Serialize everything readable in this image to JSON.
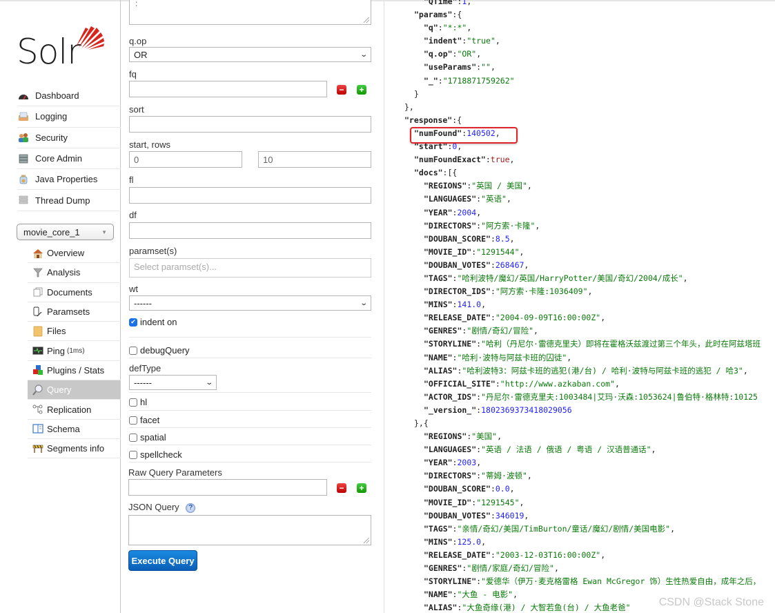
{
  "app": {
    "logo_text": "Solr",
    "brand_color": "#d9261c",
    "accent_color": "#0a6fd0"
  },
  "sidebar": {
    "main_items": [
      {
        "label": "Dashboard",
        "icon": "dashboard-gauge-icon"
      },
      {
        "label": "Logging",
        "icon": "logging-inbox-icon"
      },
      {
        "label": "Security",
        "icon": "security-users-icon"
      },
      {
        "label": "Core Admin",
        "icon": "core-admin-server-icon"
      },
      {
        "label": "Java Properties",
        "icon": "java-properties-jar-icon"
      },
      {
        "label": "Thread Dump",
        "icon": "thread-dump-stack-icon"
      }
    ],
    "core_selector": {
      "value": "movie_core_1"
    },
    "core_items": [
      {
        "label": "Overview",
        "icon": "overview-house-icon"
      },
      {
        "label": "Analysis",
        "icon": "analysis-funnel-icon"
      },
      {
        "label": "Documents",
        "icon": "documents-icon"
      },
      {
        "label": "Paramsets",
        "icon": "paramsets-pencil-icon"
      },
      {
        "label": "Files",
        "icon": "files-folder-icon"
      },
      {
        "label": "Ping",
        "suffix": "(1ms)",
        "icon": "ping-monitor-icon"
      },
      {
        "label": "Plugins / Stats",
        "icon": "plugins-blocks-icon"
      },
      {
        "label": "Query",
        "icon": "query-magnifier-icon",
        "active": true
      },
      {
        "label": "Replication",
        "icon": "replication-nodes-icon"
      },
      {
        "label": "Schema",
        "icon": "schema-book-icon"
      },
      {
        "label": "Segments info",
        "icon": "segments-barrier-icon"
      }
    ]
  },
  "form": {
    "q_value": ":",
    "qop": {
      "label": "q.op",
      "value": "OR"
    },
    "fq": {
      "label": "fq",
      "value": ""
    },
    "sort": {
      "label": "sort",
      "value": ""
    },
    "start_rows": {
      "label": "start, rows",
      "start": "0",
      "rows": "10"
    },
    "fl": {
      "label": "fl",
      "value": ""
    },
    "df": {
      "label": "df",
      "value": ""
    },
    "paramsets": {
      "label": "paramset(s)",
      "placeholder": "Select paramset(s)..."
    },
    "wt": {
      "label": "wt",
      "value": "------"
    },
    "indent": {
      "label": "indent on",
      "checked": true
    },
    "debugQuery": {
      "label": "debugQuery",
      "checked": false
    },
    "defType": {
      "label": "defType",
      "value": "------"
    },
    "hl": {
      "label": "hl",
      "checked": false
    },
    "facet": {
      "label": "facet",
      "checked": false
    },
    "spatial": {
      "label": "spatial",
      "checked": false
    },
    "spellcheck": {
      "label": "spellcheck",
      "checked": false
    },
    "raw": {
      "label": "Raw Query Parameters",
      "value": ""
    },
    "json_query": {
      "label": "JSON Query",
      "help": "?",
      "value": ""
    },
    "execute_label": "Execute Query"
  },
  "response_lines": [
    [
      4,
      [
        [
          "k",
          "\"QTime\""
        ],
        [
          "p",
          ":"
        ],
        [
          "n",
          "1"
        ],
        [
          "p",
          ","
        ]
      ]
    ],
    [
      2,
      [
        [
          "k",
          "\"params\""
        ],
        [
          "p",
          ":{"
        ]
      ]
    ],
    [
      4,
      [
        [
          "k",
          "\"q\""
        ],
        [
          "p",
          ":"
        ],
        [
          "s",
          "\"*:*\""
        ],
        [
          "p",
          ","
        ]
      ]
    ],
    [
      4,
      [
        [
          "k",
          "\"indent\""
        ],
        [
          "p",
          ":"
        ],
        [
          "s",
          "\"true\""
        ],
        [
          "p",
          ","
        ]
      ]
    ],
    [
      4,
      [
        [
          "k",
          "\"q.op\""
        ],
        [
          "p",
          ":"
        ],
        [
          "s",
          "\"OR\""
        ],
        [
          "p",
          ","
        ]
      ]
    ],
    [
      4,
      [
        [
          "k",
          "\"useParams\""
        ],
        [
          "p",
          ":"
        ],
        [
          "s",
          "\"\""
        ],
        [
          "p",
          ","
        ]
      ]
    ],
    [
      4,
      [
        [
          "k",
          "\"_\""
        ],
        [
          "p",
          ":"
        ],
        [
          "s",
          "\"1718871759262\""
        ]
      ]
    ],
    [
      2,
      [
        [
          "p",
          "}"
        ]
      ]
    ],
    [
      0,
      [
        [
          "p",
          "},"
        ]
      ]
    ],
    [
      0,
      [
        [
          "k",
          "\"response\""
        ],
        [
          "p",
          ":{"
        ]
      ]
    ],
    [
      2,
      [
        [
          "k",
          "\"numFound\""
        ],
        [
          "p",
          ":"
        ],
        [
          "n",
          "140502"
        ],
        [
          "p",
          ","
        ]
      ]
    ],
    [
      2,
      [
        [
          "k",
          "\"start\""
        ],
        [
          "p",
          ":"
        ],
        [
          "n",
          "0"
        ],
        [
          "p",
          ","
        ]
      ]
    ],
    [
      2,
      [
        [
          "k",
          "\"numFoundExact\""
        ],
        [
          "p",
          ":"
        ],
        [
          "b",
          "true"
        ],
        [
          "p",
          ","
        ]
      ]
    ],
    [
      2,
      [
        [
          "k",
          "\"docs\""
        ],
        [
          "p",
          ":[{"
        ]
      ]
    ],
    [
      4,
      [
        [
          "k",
          "\"REGIONS\""
        ],
        [
          "p",
          ":"
        ],
        [
          "s",
          "\"英国 / 美国\""
        ],
        [
          "p",
          ","
        ]
      ]
    ],
    [
      4,
      [
        [
          "k",
          "\"LANGUAGES\""
        ],
        [
          "p",
          ":"
        ],
        [
          "s",
          "\"英语\""
        ],
        [
          "p",
          ","
        ]
      ]
    ],
    [
      4,
      [
        [
          "k",
          "\"YEAR\""
        ],
        [
          "p",
          ":"
        ],
        [
          "n",
          "2004"
        ],
        [
          "p",
          ","
        ]
      ]
    ],
    [
      4,
      [
        [
          "k",
          "\"DIRECTORS\""
        ],
        [
          "p",
          ":"
        ],
        [
          "s",
          "\"阿方索·卡隆\""
        ],
        [
          "p",
          ","
        ]
      ]
    ],
    [
      4,
      [
        [
          "k",
          "\"DOUBAN_SCORE\""
        ],
        [
          "p",
          ":"
        ],
        [
          "n",
          "8.5"
        ],
        [
          "p",
          ","
        ]
      ]
    ],
    [
      4,
      [
        [
          "k",
          "\"MOVIE_ID\""
        ],
        [
          "p",
          ":"
        ],
        [
          "s",
          "\"1291544\""
        ],
        [
          "p",
          ","
        ]
      ]
    ],
    [
      4,
      [
        [
          "k",
          "\"DOUBAN_VOTES\""
        ],
        [
          "p",
          ":"
        ],
        [
          "n",
          "268467"
        ],
        [
          "p",
          ","
        ]
      ]
    ],
    [
      4,
      [
        [
          "k",
          "\"TAGS\""
        ],
        [
          "p",
          ":"
        ],
        [
          "s",
          "\"哈利波特/魔幻/英国/HarryPotter/美国/奇幻/2004/成长\""
        ],
        [
          "p",
          ","
        ]
      ]
    ],
    [
      4,
      [
        [
          "k",
          "\"DIRECTOR_IDS\""
        ],
        [
          "p",
          ":"
        ],
        [
          "s",
          "\"阿方索·卡隆:1036409\""
        ],
        [
          "p",
          ","
        ]
      ]
    ],
    [
      4,
      [
        [
          "k",
          "\"MINS\""
        ],
        [
          "p",
          ":"
        ],
        [
          "n",
          "141.0"
        ],
        [
          "p",
          ","
        ]
      ]
    ],
    [
      4,
      [
        [
          "k",
          "\"RELEASE_DATE\""
        ],
        [
          "p",
          ":"
        ],
        [
          "s",
          "\"2004-09-09T16:00:00Z\""
        ],
        [
          "p",
          ","
        ]
      ]
    ],
    [
      4,
      [
        [
          "k",
          "\"GENRES\""
        ],
        [
          "p",
          ":"
        ],
        [
          "s",
          "\"剧情/奇幻/冒险\""
        ],
        [
          "p",
          ","
        ]
      ]
    ],
    [
      4,
      [
        [
          "k",
          "\"STORYLINE\""
        ],
        [
          "p",
          ":"
        ],
        [
          "s",
          "\"哈利（丹尼尔·雷德克里夫）即将在霍格沃兹渡过第三个年头，此时在阿兹塔班"
        ]
      ]
    ],
    [
      4,
      [
        [
          "k",
          "\"NAME\""
        ],
        [
          "p",
          ":"
        ],
        [
          "s",
          "\"哈利·波特与阿兹卡班的囚徒\""
        ],
        [
          "p",
          ","
        ]
      ]
    ],
    [
      4,
      [
        [
          "k",
          "\"ALIAS\""
        ],
        [
          "p",
          ":"
        ],
        [
          "s",
          "\"哈利波特3：阿兹卡班的逃犯(港/台) / 哈利·波特与阿兹卡班的逃犯 / 哈3\""
        ],
        [
          "p",
          ","
        ]
      ]
    ],
    [
      4,
      [
        [
          "k",
          "\"OFFICIAL_SITE\""
        ],
        [
          "p",
          ":"
        ],
        [
          "s",
          "\"http://www.azkaban.com\""
        ],
        [
          "p",
          ","
        ]
      ]
    ],
    [
      4,
      [
        [
          "k",
          "\"ACTOR_IDS\""
        ],
        [
          "p",
          ":"
        ],
        [
          "s",
          "\"丹尼尔·雷德克里夫:1003484|艾玛·沃森:1053624|鲁伯特·格林特:10125"
        ]
      ]
    ],
    [
      4,
      [
        [
          "k",
          "\"_version_\""
        ],
        [
          "p",
          ":"
        ],
        [
          "n",
          "1802369373418029056"
        ]
      ]
    ],
    [
      2,
      [
        [
          "p",
          "},{"
        ]
      ]
    ],
    [
      4,
      [
        [
          "k",
          "\"REGIONS\""
        ],
        [
          "p",
          ":"
        ],
        [
          "s",
          "\"美国\""
        ],
        [
          "p",
          ","
        ]
      ]
    ],
    [
      4,
      [
        [
          "k",
          "\"LANGUAGES\""
        ],
        [
          "p",
          ":"
        ],
        [
          "s",
          "\"英语 / 法语 / 俄语 / 粤语 / 汉语普通话\""
        ],
        [
          "p",
          ","
        ]
      ]
    ],
    [
      4,
      [
        [
          "k",
          "\"YEAR\""
        ],
        [
          "p",
          ":"
        ],
        [
          "n",
          "2003"
        ],
        [
          "p",
          ","
        ]
      ]
    ],
    [
      4,
      [
        [
          "k",
          "\"DIRECTORS\""
        ],
        [
          "p",
          ":"
        ],
        [
          "s",
          "\"蒂姆·波顿\""
        ],
        [
          "p",
          ","
        ]
      ]
    ],
    [
      4,
      [
        [
          "k",
          "\"DOUBAN_SCORE\""
        ],
        [
          "p",
          ":"
        ],
        [
          "n",
          "0.0"
        ],
        [
          "p",
          ","
        ]
      ]
    ],
    [
      4,
      [
        [
          "k",
          "\"MOVIE_ID\""
        ],
        [
          "p",
          ":"
        ],
        [
          "s",
          "\"1291545\""
        ],
        [
          "p",
          ","
        ]
      ]
    ],
    [
      4,
      [
        [
          "k",
          "\"DOUBAN_VOTES\""
        ],
        [
          "p",
          ":"
        ],
        [
          "n",
          "346019"
        ],
        [
          "p",
          ","
        ]
      ]
    ],
    [
      4,
      [
        [
          "k",
          "\"TAGS\""
        ],
        [
          "p",
          ":"
        ],
        [
          "s",
          "\"亲情/奇幻/美国/TimBurton/童话/魔幻/剧情/美国电影\""
        ],
        [
          "p",
          ","
        ]
      ]
    ],
    [
      4,
      [
        [
          "k",
          "\"MINS\""
        ],
        [
          "p",
          ":"
        ],
        [
          "n",
          "125.0"
        ],
        [
          "p",
          ","
        ]
      ]
    ],
    [
      4,
      [
        [
          "k",
          "\"RELEASE_DATE\""
        ],
        [
          "p",
          ":"
        ],
        [
          "s",
          "\"2003-12-03T16:00:00Z\""
        ],
        [
          "p",
          ","
        ]
      ]
    ],
    [
      4,
      [
        [
          "k",
          "\"GENRES\""
        ],
        [
          "p",
          ":"
        ],
        [
          "s",
          "\"剧情/家庭/奇幻/冒险\""
        ],
        [
          "p",
          ","
        ]
      ]
    ],
    [
      4,
      [
        [
          "k",
          "\"STORYLINE\""
        ],
        [
          "p",
          ":"
        ],
        [
          "s",
          "\"爱德华（伊万·麦克格雷格 Ewan McGregor 饰）生性热爱自由，成年之后，"
        ]
      ]
    ],
    [
      4,
      [
        [
          "k",
          "\"NAME\""
        ],
        [
          "p",
          ":"
        ],
        [
          "s",
          "\"大鱼 - 电影\""
        ],
        [
          "p",
          ","
        ]
      ]
    ],
    [
      4,
      [
        [
          "k",
          "\"ALIAS\""
        ],
        [
          "p",
          ":"
        ],
        [
          "s",
          "\"大鱼奇缘(港) / 大智若鱼(台) / 大鱼老爸\""
        ]
      ]
    ]
  ],
  "highlight": {
    "label": "numFound",
    "value": 140502,
    "color": "#e0242b"
  },
  "watermark": "CSDN @Stack Stone"
}
